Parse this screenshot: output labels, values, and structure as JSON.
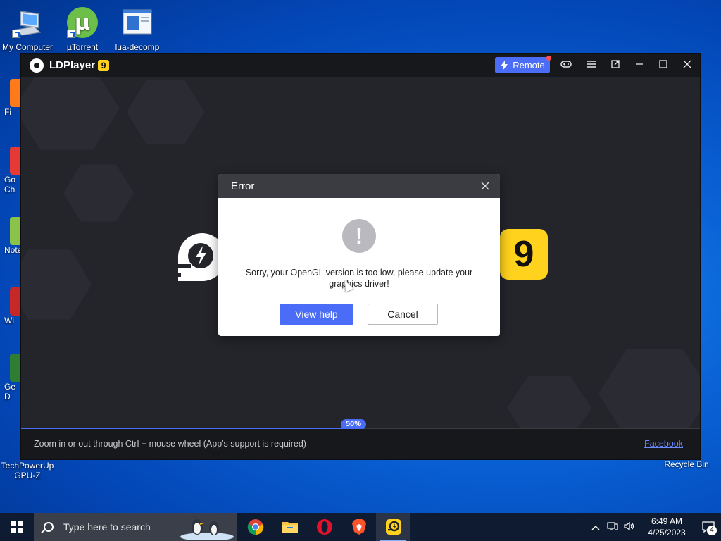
{
  "desktop": {
    "icons": [
      {
        "label": "My Computer",
        "icon": "computer-icon"
      },
      {
        "label": "µTorrent",
        "icon": "utorrent-icon"
      },
      {
        "label": "lua-decomp",
        "icon": "window-icon"
      },
      {
        "label": "Recycle Bin",
        "icon": "recycle-bin-icon"
      },
      {
        "label": "TechPowerUp GPU-Z",
        "icon": "gpuz-icon"
      }
    ],
    "partial_icons": [
      {
        "label": "Fi",
        "color": "#ff7a1a"
      },
      {
        "label": "Go Ch",
        "color": "#e53935"
      },
      {
        "label": "Note",
        "color": "#8bc34a"
      },
      {
        "label": "Wi",
        "color": "#c62828"
      },
      {
        "label": "Ge D",
        "color": "#2e7d32"
      }
    ]
  },
  "ldplayer": {
    "title": "LDPlayer",
    "badge": "9",
    "remote_label": "Remote",
    "toolbar_icons": [
      "gamepad-icon",
      "menu-icon",
      "external-icon",
      "minimize-icon",
      "maximize-icon",
      "close-icon"
    ],
    "splash_badge": "9",
    "progress": {
      "percent": 50,
      "label": "50%"
    },
    "status_tip": "Zoom in or out through Ctrl + mouse wheel (App's support is required)",
    "facebook_link": "Facebook"
  },
  "error_dialog": {
    "title": "Error",
    "icon_glyph": "!",
    "message": "Sorry, your OpenGL version is too low, please update your graphics driver!",
    "view_help_label": "View help",
    "cancel_label": "Cancel"
  },
  "taskbar": {
    "search_placeholder": "Type here to search",
    "apps": [
      "chrome-icon",
      "file-explorer-icon",
      "opera-icon",
      "brave-icon",
      "ldplayer-icon"
    ],
    "active_app": "ldplayer-icon",
    "clock_time": "6:49 AM",
    "clock_date": "4/25/2023",
    "notification_count": "4"
  },
  "colors": {
    "accent": "#4a6cf7",
    "ld_badge": "#ffd21e",
    "dialog_header": "#3b3c42"
  }
}
